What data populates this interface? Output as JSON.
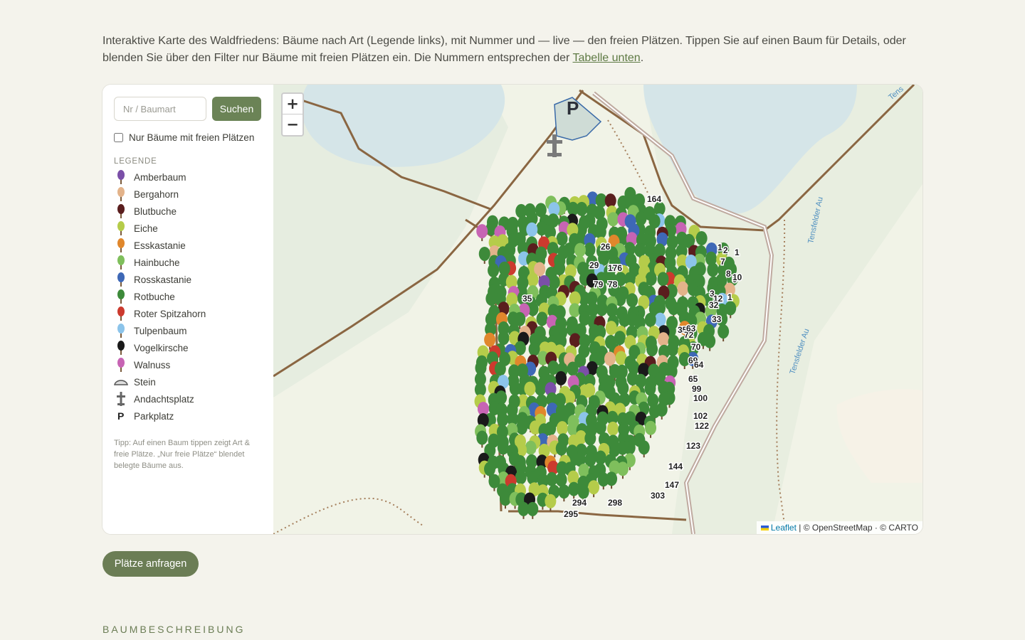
{
  "intro": {
    "text_before": "Interaktive Karte des Waldfriedens: Bäume nach Art (Legende links), mit Nummer und — live — den freien Plätzen. Tippen Sie auf einen Baum für Details, oder blenden Sie über den Filter nur Bäume mit freien Plätzen ein. Die Nummern entsprechen der ",
    "link_text": "Tabelle unten",
    "text_after": "."
  },
  "panel": {
    "search_placeholder": "Nr / Baumart",
    "search_button": "Suchen",
    "filter_label": "Nur Bäume mit freien Plätzen",
    "legend_title": "LEGENDE",
    "legend": [
      {
        "label": "Amberbaum",
        "color": "#7b4fa8",
        "icon": "tree-icon"
      },
      {
        "label": "Bergahorn",
        "color": "#e3b38a",
        "icon": "tree-icon"
      },
      {
        "label": "Blutbuche",
        "color": "#5a1e1e",
        "icon": "tree-icon"
      },
      {
        "label": "Eiche",
        "color": "#b5cc4a",
        "icon": "tree-icon"
      },
      {
        "label": "Esskastanie",
        "color": "#e0872c",
        "icon": "tree-icon"
      },
      {
        "label": "Hainbuche",
        "color": "#7fbf5c",
        "icon": "tree-icon"
      },
      {
        "label": "Rosskastanie",
        "color": "#3e68b6",
        "icon": "tree-icon"
      },
      {
        "label": "Rotbuche",
        "color": "#3d8a3a",
        "icon": "tree-icon"
      },
      {
        "label": "Roter Spitzahorn",
        "color": "#cc3a2e",
        "icon": "tree-icon"
      },
      {
        "label": "Tulpenbaum",
        "color": "#8cc4ea",
        "icon": "tree-icon"
      },
      {
        "label": "Vogelkirsche",
        "color": "#1a1a1a",
        "icon": "tree-icon"
      },
      {
        "label": "Walnuss",
        "color": "#c764b4",
        "icon": "tree-icon"
      },
      {
        "label": "Stein",
        "color": "#555555",
        "icon": "stone-icon"
      },
      {
        "label": "Andachtsplatz",
        "color": "#666666",
        "icon": "cross-icon"
      },
      {
        "label": "Parkplatz",
        "color": "#222222",
        "icon": "parking-icon"
      }
    ],
    "tip": "Tipp: Auf einen Baum tippen zeigt Art & freie Plätze. „Nur freie Plätze“ blendet belegte Bäume aus."
  },
  "map": {
    "zoom_in": "+",
    "zoom_out": "−",
    "attribution_leaflet": "Leaflet",
    "attribution_rest": " | © OpenStreetMap · © CARTO",
    "parking_label": "P",
    "stream_labels": [
      "Tensfelder Au",
      "Tensfelder Au",
      "Tens"
    ],
    "tree_numbers": [
      "164",
      "176",
      "79",
      "78",
      "2",
      "1",
      "7",
      "8",
      "9",
      "10",
      "3",
      "1",
      "12",
      "32",
      "33",
      "35",
      "72",
      "63",
      "70",
      "69",
      "64",
      "65",
      "99",
      "100",
      "102",
      "122",
      "123",
      "144",
      "147",
      "303",
      "298",
      "294",
      "295",
      "35",
      "26",
      "29",
      "1"
    ]
  },
  "cta_label": "Plätze anfragen",
  "section_title": "BAUMBESCHREIBUNG"
}
